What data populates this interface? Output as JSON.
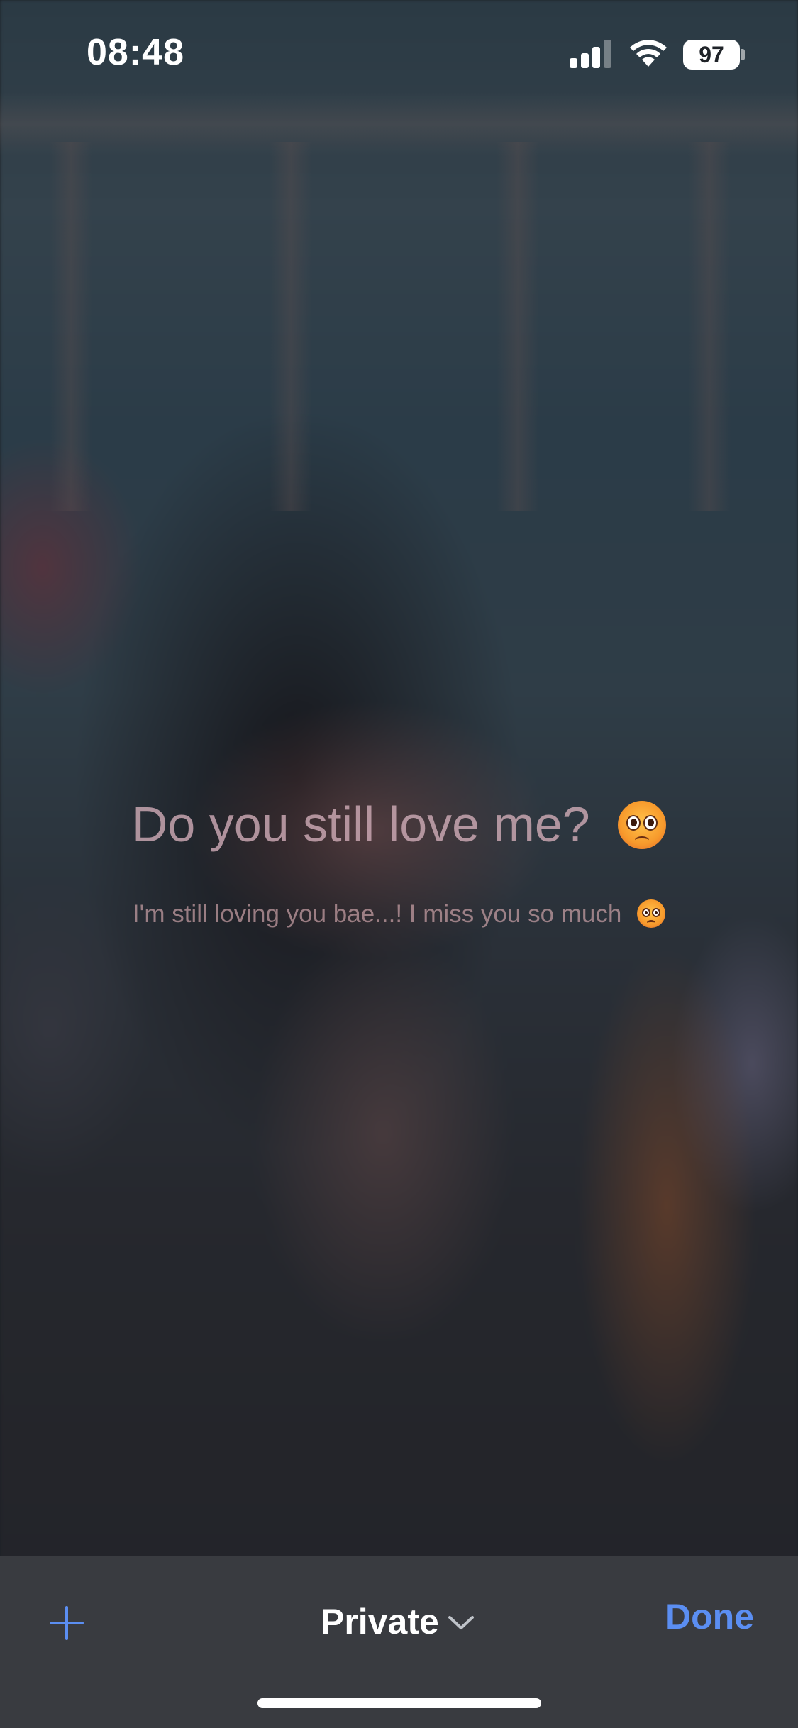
{
  "status_bar": {
    "time": "08:48",
    "battery_level": "97",
    "signal_bars": 3,
    "icons": [
      "cellular-signal-icon",
      "wifi-icon",
      "battery-icon"
    ]
  },
  "content": {
    "title": "Do you still love me?",
    "title_emoji": "pleading-face-emoji",
    "subtitle": "I'm still loving you bae...! I miss you so much",
    "subtitle_emoji": "pleading-face-emoji"
  },
  "toolbar": {
    "add_icon": "plus-icon",
    "privacy_label": "Private",
    "privacy_icon": "chevron-down-icon",
    "done_label": "Done"
  },
  "colors": {
    "accent": "#5b8ef2",
    "toolbar_bg": "#3a3c42",
    "text_primary": "#ffffff"
  }
}
